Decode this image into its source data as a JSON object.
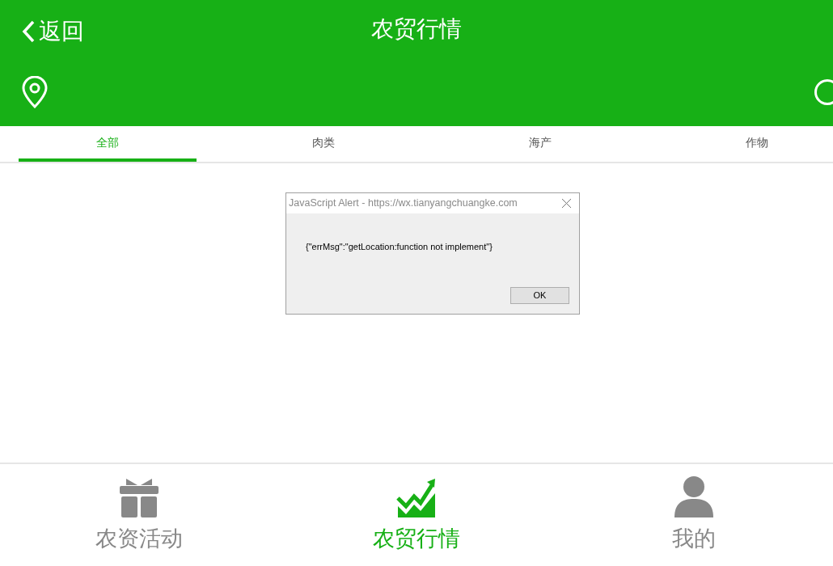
{
  "header": {
    "back_label": "返回",
    "title": "农贸行情"
  },
  "tabs": [
    {
      "label": "全部",
      "selected": true
    },
    {
      "label": "肉类",
      "selected": false
    },
    {
      "label": "海产",
      "selected": false
    },
    {
      "label": "作物",
      "selected": false
    }
  ],
  "alert": {
    "title": "JavaScript Alert - https://wx.tianyangchuangke.com",
    "message": "{\"errMsg\":\"getLocation:function not implement\"}",
    "button": "OK"
  },
  "bottom_nav": [
    {
      "kind": "gift",
      "label": "农资活动",
      "selected": false
    },
    {
      "kind": "chart",
      "label": "农贸行情",
      "selected": true
    },
    {
      "kind": "user",
      "label": "我的",
      "selected": false
    }
  ]
}
